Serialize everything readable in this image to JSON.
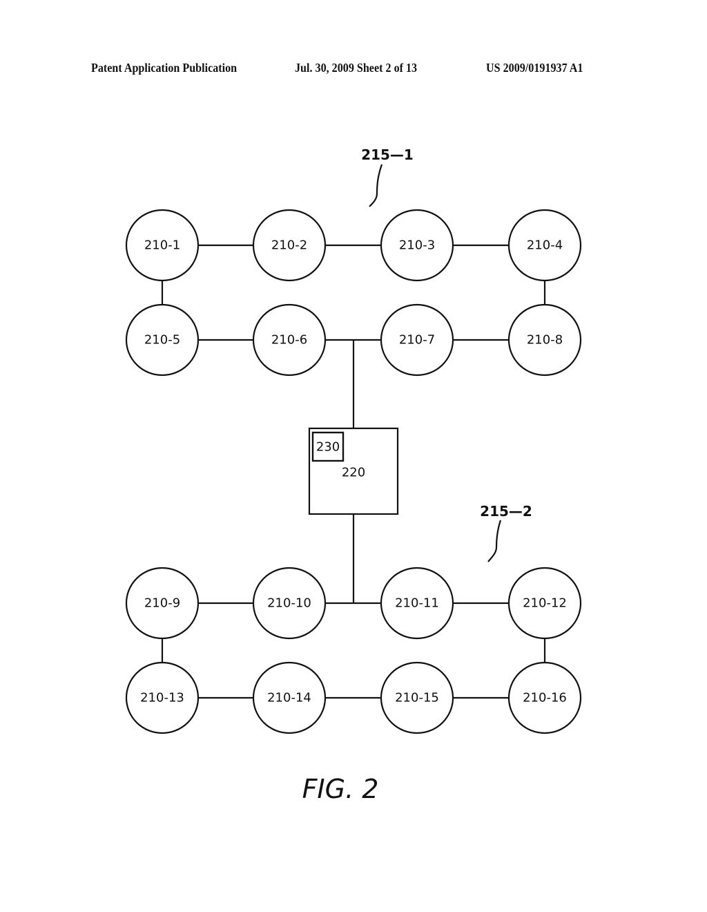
{
  "header": {
    "left": "Patent Application Publication",
    "middle": "Jul. 30, 2009   Sheet 2 of 13",
    "right": "US 2009/0191937 A1"
  },
  "figure": {
    "caption": "FIG. 2",
    "groups": [
      {
        "id": "215-1",
        "label": "215—1"
      },
      {
        "id": "215-2",
        "label": "215—2"
      }
    ],
    "controller": {
      "label": "220",
      "sub_component_label": "230"
    },
    "nodes": [
      {
        "id": "210-1",
        "label": "210-1",
        "group": "215-1",
        "row": 0,
        "col": 0
      },
      {
        "id": "210-2",
        "label": "210-2",
        "group": "215-1",
        "row": 0,
        "col": 1
      },
      {
        "id": "210-3",
        "label": "210-3",
        "group": "215-1",
        "row": 0,
        "col": 2
      },
      {
        "id": "210-4",
        "label": "210-4",
        "group": "215-1",
        "row": 0,
        "col": 3
      },
      {
        "id": "210-5",
        "label": "210-5",
        "group": "215-1",
        "row": 1,
        "col": 0
      },
      {
        "id": "210-6",
        "label": "210-6",
        "group": "215-1",
        "row": 1,
        "col": 1
      },
      {
        "id": "210-7",
        "label": "210-7",
        "group": "215-1",
        "row": 1,
        "col": 2
      },
      {
        "id": "210-8",
        "label": "210-8",
        "group": "215-1",
        "row": 1,
        "col": 3
      },
      {
        "id": "210-9",
        "label": "210-9",
        "group": "215-2",
        "row": 2,
        "col": 0
      },
      {
        "id": "210-10",
        "label": "210-10",
        "group": "215-2",
        "row": 2,
        "col": 1
      },
      {
        "id": "210-11",
        "label": "210-11",
        "group": "215-2",
        "row": 2,
        "col": 2
      },
      {
        "id": "210-12",
        "label": "210-12",
        "group": "215-2",
        "row": 2,
        "col": 3
      },
      {
        "id": "210-13",
        "label": "210-13",
        "group": "215-2",
        "row": 3,
        "col": 0
      },
      {
        "id": "210-14",
        "label": "210-14",
        "group": "215-2",
        "row": 3,
        "col": 1
      },
      {
        "id": "210-15",
        "label": "210-15",
        "group": "215-2",
        "row": 3,
        "col": 2
      },
      {
        "id": "210-16",
        "label": "210-16",
        "group": "215-2",
        "row": 3,
        "col": 3
      }
    ],
    "links": [
      [
        "210-1",
        "210-2"
      ],
      [
        "210-2",
        "210-3"
      ],
      [
        "210-3",
        "210-4"
      ],
      [
        "210-1",
        "210-5"
      ],
      [
        "210-4",
        "210-8"
      ],
      [
        "210-5",
        "210-6"
      ],
      [
        "210-6",
        "210-7"
      ],
      [
        "210-7",
        "210-8"
      ],
      [
        "210-9",
        "210-10"
      ],
      [
        "210-10",
        "210-11"
      ],
      [
        "210-11",
        "210-12"
      ],
      [
        "210-9",
        "210-13"
      ],
      [
        "210-12",
        "210-16"
      ],
      [
        "210-13",
        "210-14"
      ],
      [
        "210-14",
        "210-15"
      ],
      [
        "210-15",
        "210-16"
      ]
    ],
    "controller_links": [
      {
        "between": [
          "210-6",
          "210-7"
        ]
      },
      {
        "between": [
          "210-10",
          "210-11"
        ]
      }
    ]
  }
}
